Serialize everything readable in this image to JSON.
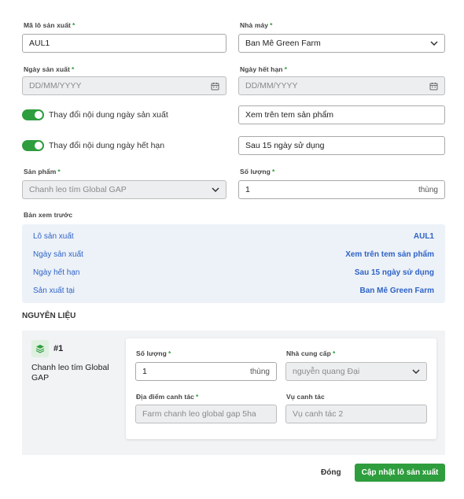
{
  "form": {
    "batch_code": {
      "label": "Mã lô sản xuất",
      "value": "AUL1"
    },
    "factory": {
      "label": "Nhà máy",
      "value": "Ban Mê Green Farm"
    },
    "mfg_date": {
      "label": "Ngày sản xuất",
      "placeholder": "DD/MM/YYYY"
    },
    "exp_date": {
      "label": "Ngày hết hạn",
      "placeholder": "DD/MM/YYYY"
    },
    "toggle_mfg": {
      "label": "Thay đổi nội dung ngày sản xuất",
      "on": true,
      "value": "Xem trên tem sản phẩm"
    },
    "toggle_exp": {
      "label": "Thay đổi nội dung ngày hết hạn",
      "on": true,
      "value": "Sau 15 ngày sử dụng"
    },
    "product": {
      "label": "Sản phẩm",
      "value": "Chanh leo tím Global GAP"
    },
    "quantity": {
      "label": "Số lượng",
      "value": "1",
      "unit": "thùng"
    },
    "required_mark": "*"
  },
  "preview": {
    "title": "Bản xem trước",
    "rows": [
      {
        "key": "Lô sản xuất",
        "value": "AUL1"
      },
      {
        "key": "Ngày sản xuất",
        "value": "Xem trên tem sản phẩm"
      },
      {
        "key": "Ngày hết hạn",
        "value": "Sau 15 ngày sử dụng"
      },
      {
        "key": "Sản xuất tại",
        "value": "Ban Mê Green Farm"
      }
    ]
  },
  "materials": {
    "title": "NGUYÊN LIỆU",
    "items": [
      {
        "index": "#1",
        "name": "Chanh leo tím Global GAP",
        "quantity_label": "Số lượng",
        "quantity": "1",
        "unit": "thùng",
        "supplier_label": "Nhà cung cấp",
        "supplier": "nguyễn quang Đại",
        "location_label": "Địa điểm canh tác",
        "location": "Farm chanh leo global gap 5ha",
        "season_label": "Vụ canh tác",
        "season": "Vụ canh tác 2"
      }
    ]
  },
  "footer": {
    "close_label": "Đóng",
    "submit_label": "Cập nhật lô sản xuất"
  },
  "colors": {
    "accent": "#2e9d3d",
    "link": "#2f63c6",
    "preview_bg": "#edf2f8"
  }
}
